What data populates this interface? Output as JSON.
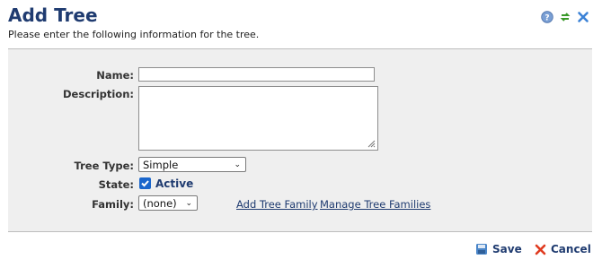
{
  "header": {
    "title": "Add Tree",
    "subtitle": "Please enter the following information for the tree.",
    "icons": [
      "help-icon",
      "refresh-icon",
      "close-icon"
    ]
  },
  "form": {
    "name_label": "Name:",
    "name_value": "",
    "description_label": "Description:",
    "description_value": "",
    "tree_type_label": "Tree Type:",
    "tree_type_value": "Simple",
    "state_label": "State:",
    "state_checked": true,
    "state_value_label": "Active",
    "family_label": "Family:",
    "family_value": "(none)",
    "add_family_link": "Add Tree Family",
    "manage_families_link": "Manage Tree Families"
  },
  "footer": {
    "save_label": "Save",
    "cancel_label": "Cancel"
  },
  "colors": {
    "title": "#1f3b70",
    "panel_bg": "#efefef",
    "checkbox": "#1a66cc",
    "cancel_x": "#e03a1f"
  }
}
